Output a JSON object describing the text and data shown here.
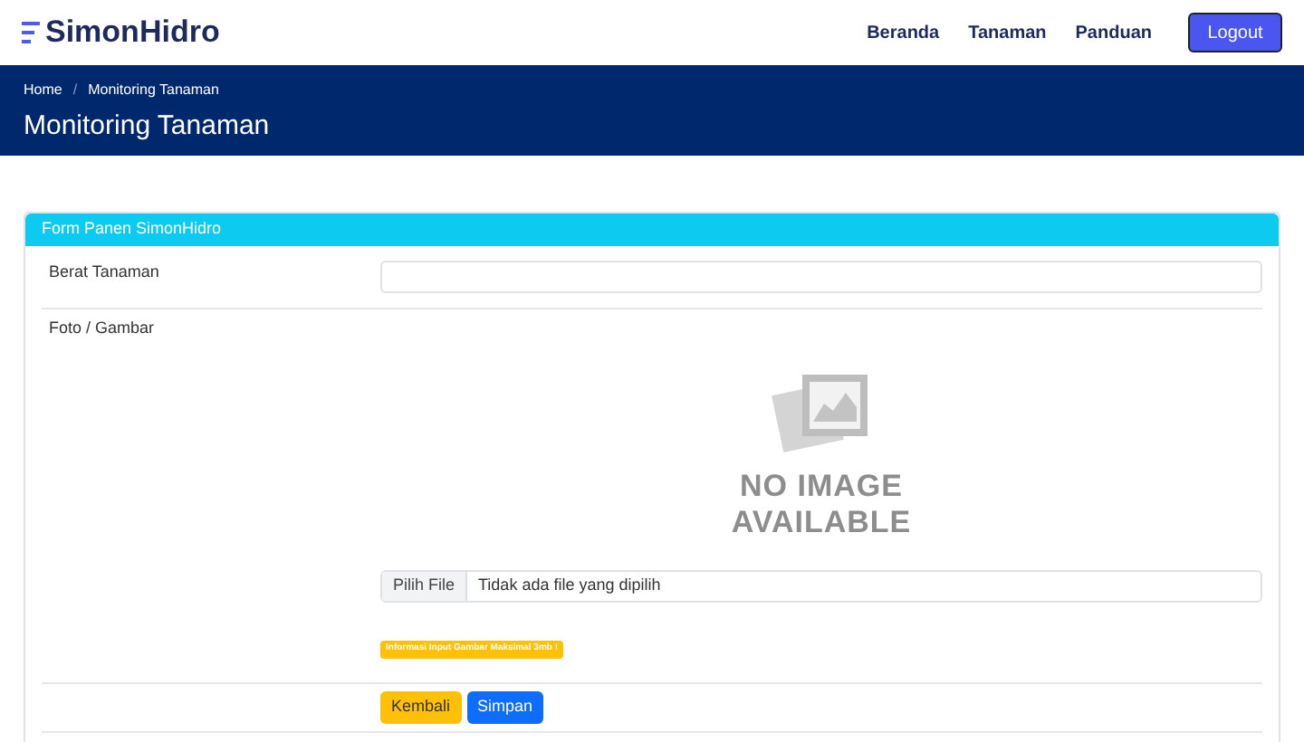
{
  "brand": "SimonHidro",
  "nav": [
    {
      "label": "Beranda"
    },
    {
      "label": "Tanaman"
    },
    {
      "label": "Panduan"
    }
  ],
  "logout": "Logout",
  "breadcrumb": [
    "Home",
    "/",
    "Monitoring Tanaman"
  ],
  "page_title": "Monitoring Tanaman",
  "card": {
    "title": "Form Panen SimonHidro",
    "weight": {
      "label": "Berat Tanaman"
    },
    "photo": {
      "label": "Foto / Gambar",
      "preview": [
        "NO IMAGE",
        "AVAILABLE"
      ],
      "file_button": "Pilih File",
      "file_status": "Tidak ada file yang dipilih",
      "note": "Informasi Input Gambar Maksimal 3mb !"
    },
    "buttons": [
      {
        "label": "Kembali",
        "kind": "back"
      },
      {
        "label": "Simpan",
        "kind": "save"
      }
    ]
  }
}
